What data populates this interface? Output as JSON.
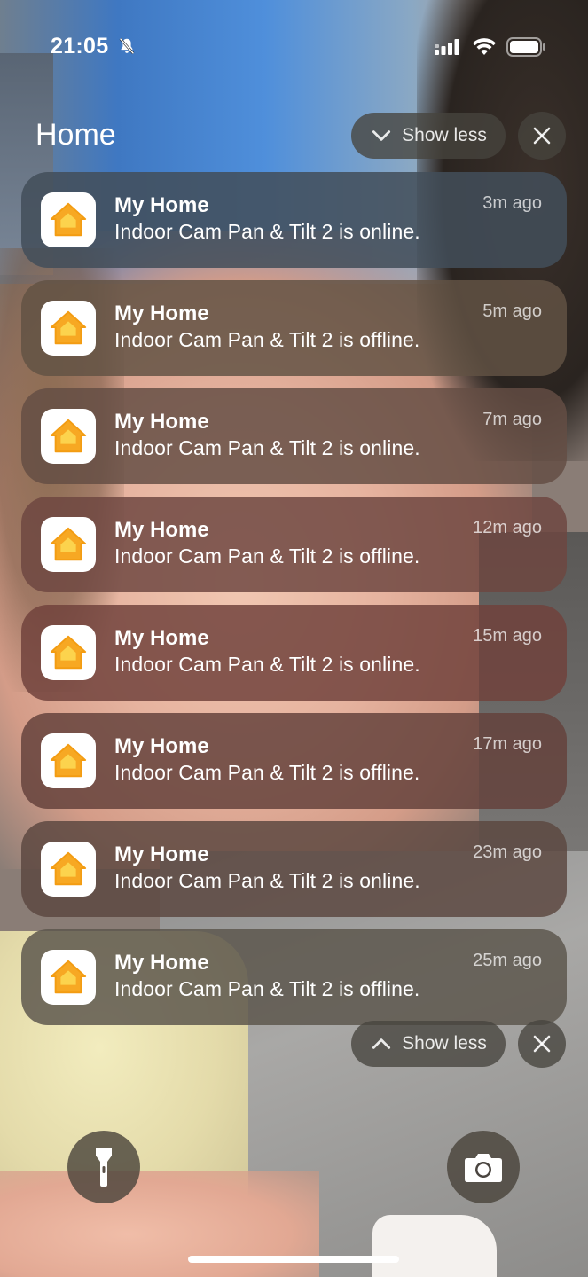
{
  "status_bar": {
    "time": "21:05",
    "icons": [
      "bell-slash-icon",
      "cellular-signal-icon",
      "wifi-icon",
      "battery-icon"
    ]
  },
  "group": {
    "title": "Home",
    "show_less_label": "Show less",
    "close_icon": "close-icon"
  },
  "notifications": [
    {
      "app": "My Home",
      "message": "Indoor Cam Pan & Tilt 2 is online.",
      "time": "3m ago"
    },
    {
      "app": "My Home",
      "message": "Indoor Cam Pan & Tilt 2 is offline.",
      "time": "5m ago"
    },
    {
      "app": "My Home",
      "message": "Indoor Cam Pan & Tilt 2 is online.",
      "time": "7m ago"
    },
    {
      "app": "My Home",
      "message": "Indoor Cam Pan & Tilt 2 is offline.",
      "time": "12m ago"
    },
    {
      "app": "My Home",
      "message": "Indoor Cam Pan & Tilt 2 is online.",
      "time": "15m ago"
    },
    {
      "app": "My Home",
      "message": "Indoor Cam Pan & Tilt 2 is offline.",
      "time": "17m ago"
    },
    {
      "app": "My Home",
      "message": "Indoor Cam Pan & Tilt 2 is online.",
      "time": "23m ago"
    },
    {
      "app": "My Home",
      "message": "Indoor Cam Pan & Tilt 2 is offline.",
      "time": "25m ago"
    }
  ],
  "bottom_controls": {
    "left_icon": "flashlight-icon",
    "right_icon": "camera-icon"
  },
  "colors": {
    "home_icon_orange": "#F7A823",
    "home_icon_light": "#FCD34D"
  }
}
